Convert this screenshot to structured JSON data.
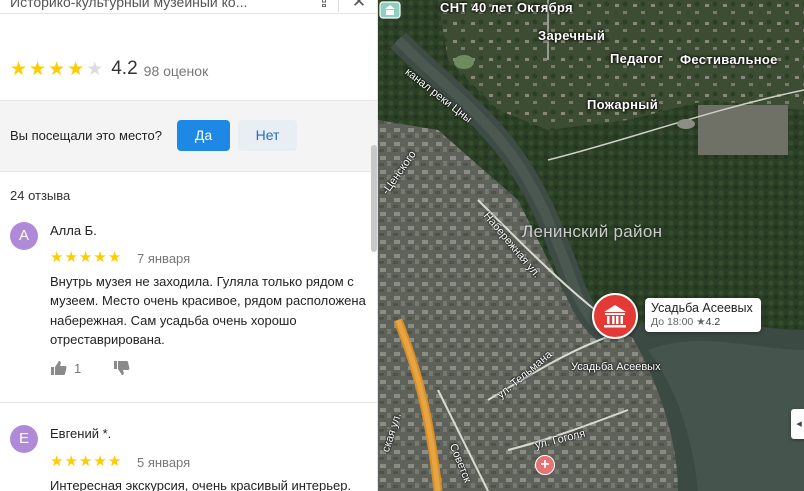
{
  "header": {
    "title": "Историко-культурный музейный ко...",
    "share_icon": "share-icon",
    "close_icon": "close-icon"
  },
  "rating": {
    "value": "4.2",
    "count_text": "98 оценок",
    "stars_filled": 4,
    "stars_total": 5
  },
  "visit": {
    "question": "Вы посещали это место?",
    "yes_label": "Да",
    "no_label": "Нет"
  },
  "reviews_count_text": "24 отзыва",
  "reviews": [
    {
      "initial": "А",
      "name": "Алла Б.",
      "stars": 5,
      "date": "7 января",
      "text": "Внутрь музея не заходила. Гуляла только рядом с музеем. Место очень красивое, рядом расположена набережная. Сам усадьба очень хорошо отреставрирована.",
      "likes": "1"
    },
    {
      "initial": "Е",
      "name": "Евгений *.",
      "stars": 5,
      "date": "5 января",
      "text": "Интересная экскурсия, очень красивый интерьер."
    }
  ],
  "map": {
    "labels": {
      "snt": "СНТ 40 лет Октября",
      "zarechny": "Заречный",
      "pedagog": "Педагог",
      "festivalnoe": "Фестивальное",
      "pozharny": "Пожарный",
      "district": "Ленинский район"
    },
    "streets": {
      "canal": "канал реки Цны",
      "tsenskogo": "-Ценского",
      "naberezhnaya": "Набережная ул.",
      "telmana": "ул. Тельмана",
      "gogolya": "ул. Гоголя",
      "sovetskaya": "Советск",
      "skaya": "ская ул."
    },
    "place": {
      "name": "Усадьба Асеевых",
      "hours": "До 18:00",
      "rating": "4.2",
      "small_label": "Усадьба Асеевых"
    },
    "accent_red": "#e53935",
    "accent_blue": "#1e88e5"
  }
}
